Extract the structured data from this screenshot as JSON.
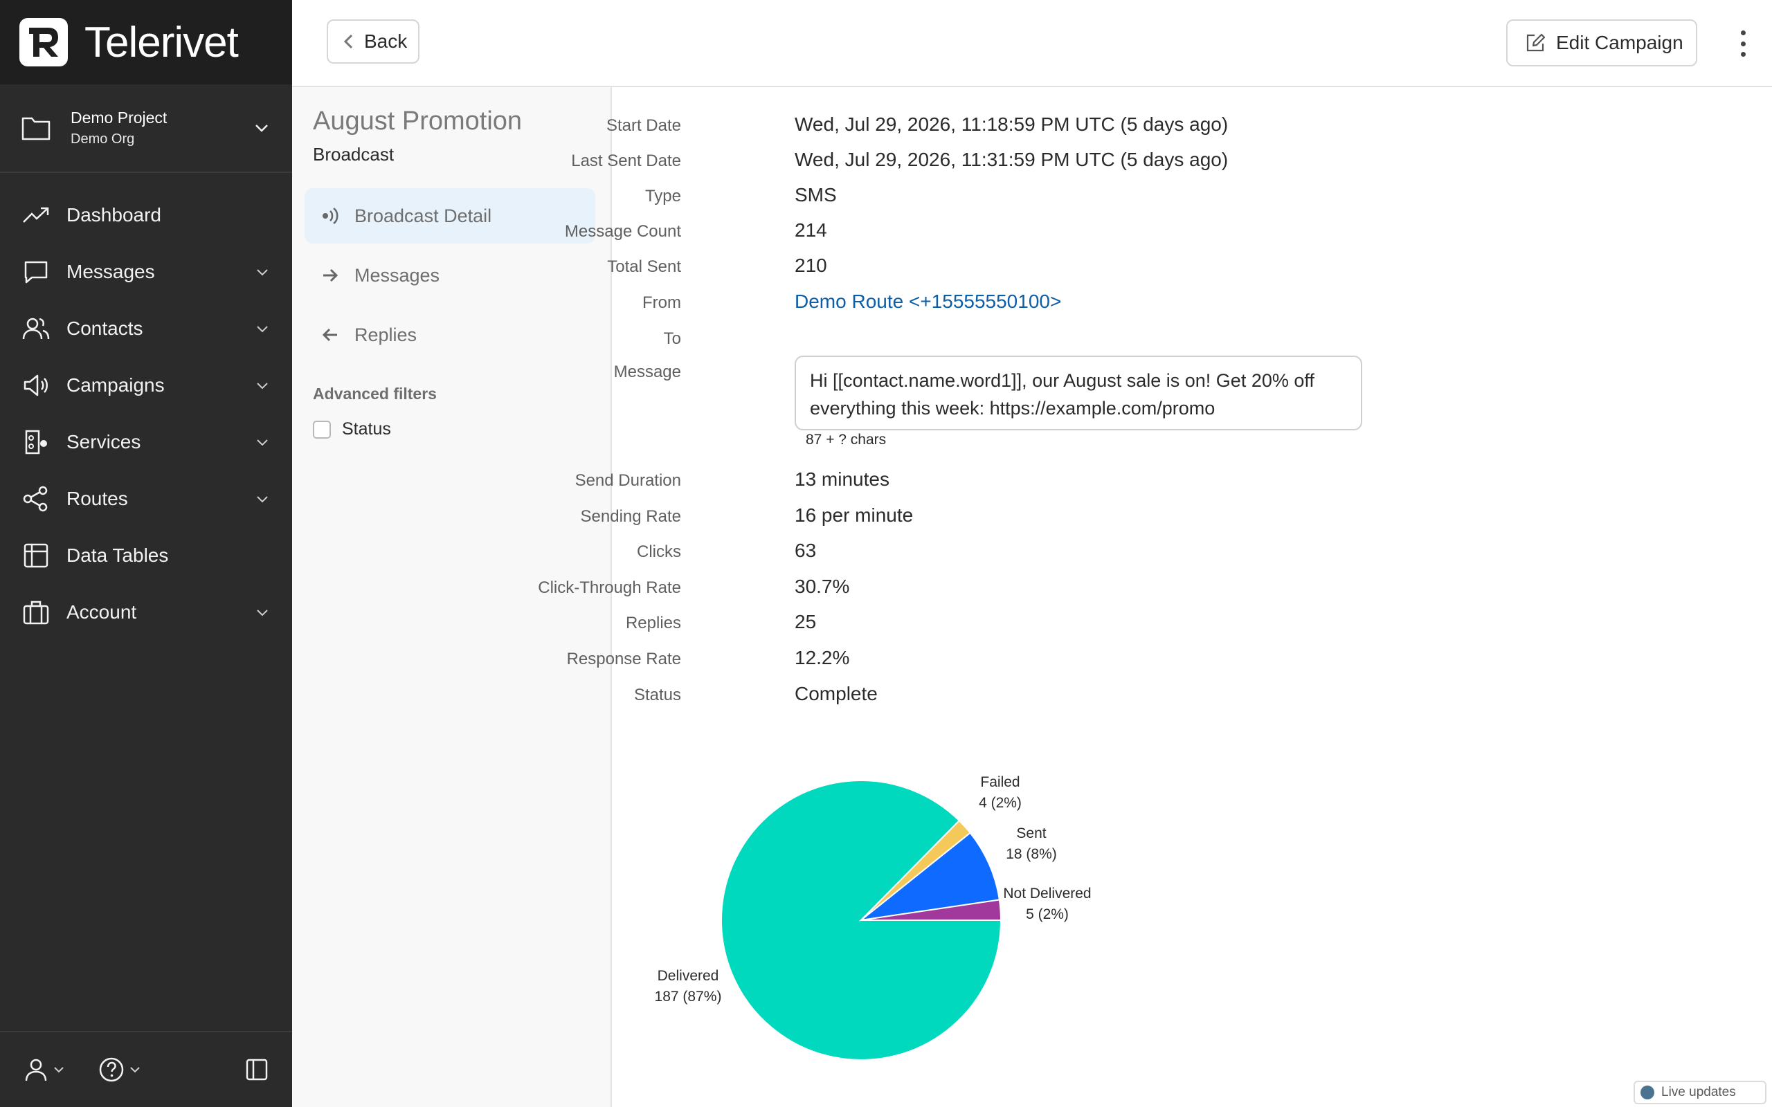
{
  "app": {
    "brand_name": "Telerivet",
    "logo_letters": "TR"
  },
  "project": {
    "name": "Demo Project",
    "org": "Demo Org"
  },
  "nav": {
    "items": [
      {
        "label": "Dashboard",
        "icon": "trending-up-icon",
        "expandable": false
      },
      {
        "label": "Messages",
        "icon": "message-square-icon",
        "expandable": true
      },
      {
        "label": "Contacts",
        "icon": "users-icon",
        "expandable": true
      },
      {
        "label": "Campaigns",
        "icon": "megaphone-icon",
        "expandable": true
      },
      {
        "label": "Services",
        "icon": "services-icon",
        "expandable": true
      },
      {
        "label": "Routes",
        "icon": "share-icon",
        "expandable": true
      },
      {
        "label": "Data Tables",
        "icon": "table-icon",
        "expandable": false
      },
      {
        "label": "Account",
        "icon": "briefcase-icon",
        "expandable": true
      }
    ]
  },
  "toolbar": {
    "back_label": "Back",
    "edit_label": "Edit Campaign"
  },
  "subpanel": {
    "title": "August Promotion",
    "subtitle": "Broadcast",
    "items": [
      {
        "label": "Broadcast Detail",
        "icon": "broadcast-icon",
        "active": true
      },
      {
        "label": "Messages",
        "icon": "arrow-right-icon",
        "active": false
      },
      {
        "label": "Replies",
        "icon": "arrow-left-icon",
        "active": false
      }
    ],
    "advanced_filters_label": "Advanced filters",
    "filter_status_label": "Status"
  },
  "details": {
    "start_date": {
      "label": "Start Date",
      "value": "Wed, Jul 29, 2026, 11:18:59 PM UTC (5 days ago)"
    },
    "last_sent_date": {
      "label": "Last Sent Date",
      "value": "Wed, Jul 29, 2026, 11:31:59 PM UTC (5 days ago)"
    },
    "type": {
      "label": "Type",
      "value": "SMS"
    },
    "message_count": {
      "label": "Message Count",
      "value": "214"
    },
    "total_sent": {
      "label": "Total Sent",
      "value": "210"
    },
    "from": {
      "label": "From",
      "value": "Demo Route <+15555550100>"
    },
    "to": {
      "label": "To",
      "value": ""
    },
    "message": {
      "label": "Message",
      "value": "Hi [[contact.name.word1]], our August sale is on! Get 20% off everything this week: https://example.com/promo",
      "char_count": "87 + ? chars"
    },
    "send_duration": {
      "label": "Send Duration",
      "value": "13 minutes"
    },
    "sending_rate": {
      "label": "Sending Rate",
      "value": "16 per minute"
    },
    "clicks": {
      "label": "Clicks",
      "value": "63"
    },
    "ctr": {
      "label": "Click-Through Rate",
      "value": "30.7%"
    },
    "replies": {
      "label": "Replies",
      "value": "25"
    },
    "response_rate": {
      "label": "Response Rate",
      "value": "12.2%"
    },
    "status": {
      "label": "Status",
      "value": "Complete"
    }
  },
  "chart_data": {
    "type": "pie",
    "slices": [
      {
        "name": "Delivered",
        "value": 187,
        "pct": "87%",
        "color": "#00d9be",
        "label_line1": "Delivered",
        "label_line2": "187 (87%)"
      },
      {
        "name": "Failed",
        "value": 4,
        "pct": "2%",
        "color": "#f5c85a",
        "label_line1": "Failed",
        "label_line2": "4 (2%)"
      },
      {
        "name": "Sent",
        "value": 18,
        "pct": "8%",
        "color": "#0f6bff",
        "label_line1": "Sent",
        "label_line2": "18 (8%)"
      },
      {
        "name": "Not Delivered",
        "value": 5,
        "pct": "2%",
        "color": "#a0399b",
        "label_line1": "Not Delivered",
        "label_line2": "5 (2%)"
      }
    ]
  },
  "live_updates": {
    "label": "Live updates"
  }
}
